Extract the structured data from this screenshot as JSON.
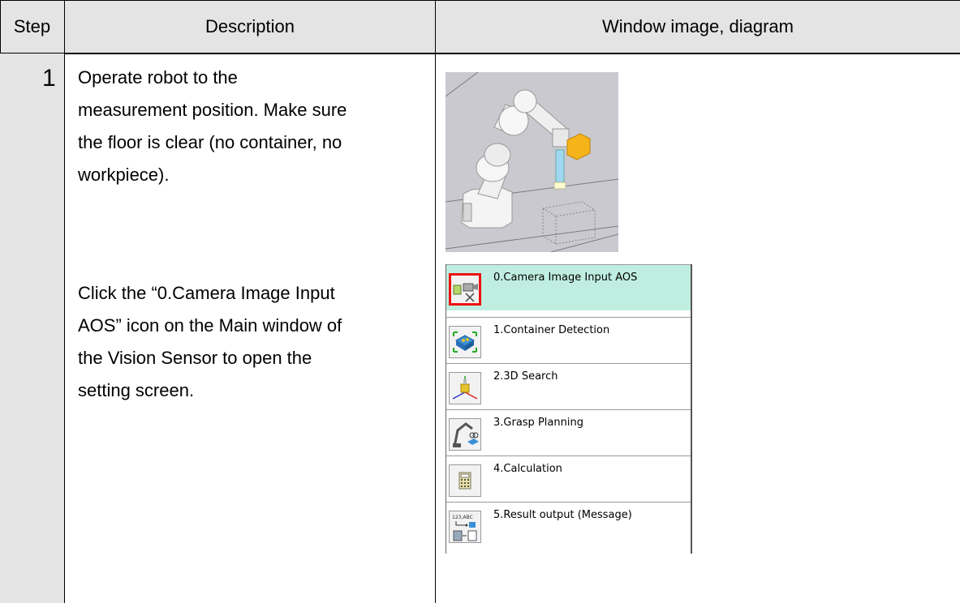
{
  "header": {
    "step": "Step",
    "description": "Description",
    "window_image": "Window  image,  diagram"
  },
  "row": {
    "step_number": "1",
    "paragraph1": [
      "Operate robot to the",
      "measurement position. Make sure",
      "the floor is clear (no container, no",
      "workpiece)."
    ],
    "paragraph2": [
      "Click the “0.Camera Image Input",
      "AOS” icon on the Main window of",
      "the Vision Sensor to open the",
      "setting screen."
    ]
  },
  "flow_items": [
    {
      "label": "0.Camera Image Input AOS",
      "icon": "camera-icon",
      "selected": true
    },
    {
      "label": "1.Container Detection",
      "icon": "container-icon",
      "selected": false
    },
    {
      "label": "2.3D Search",
      "icon": "axes-icon",
      "selected": false
    },
    {
      "label": "3.Grasp Planning",
      "icon": "robot-arm-icon",
      "selected": false
    },
    {
      "label": "4.Calculation",
      "icon": "calculator-icon",
      "selected": false
    },
    {
      "label": "5.Result output (Message)",
      "icon": "message-output-icon",
      "selected": false
    }
  ],
  "colors": {
    "header_bg": "#e4e4e4",
    "selected_bg": "#bfeee0",
    "highlight": "#e11111"
  }
}
